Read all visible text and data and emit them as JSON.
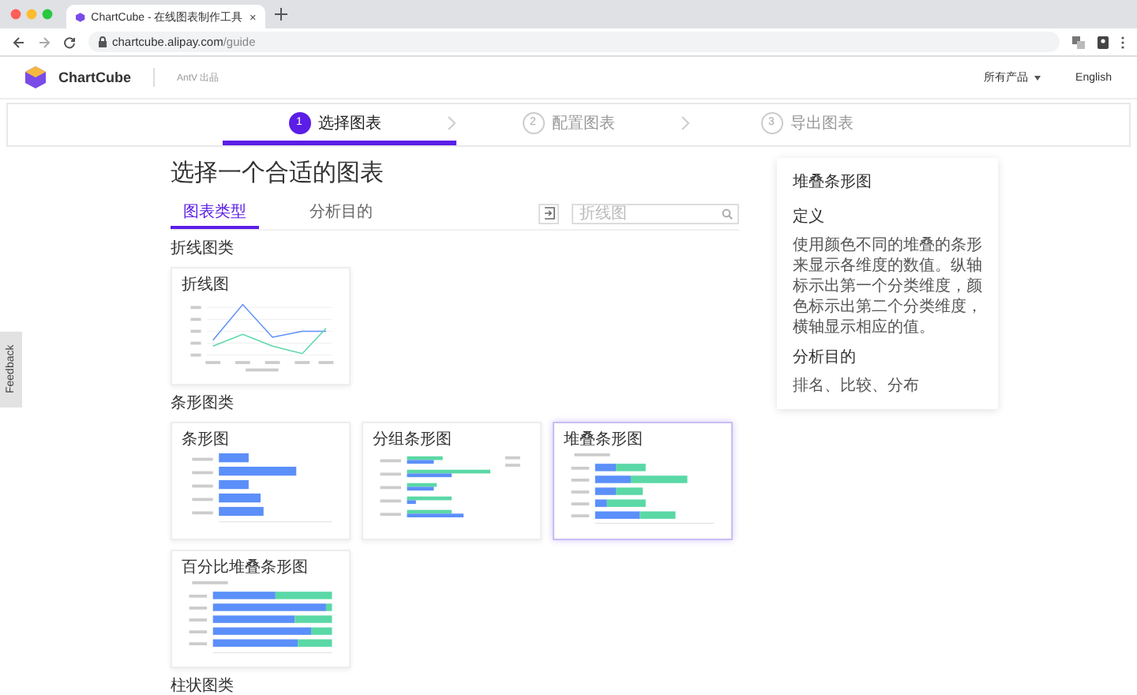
{
  "browser": {
    "tab_title": "ChartCube - 在线图表制作工具",
    "url_host": "chartcube.alipay.com",
    "url_path": "/guide"
  },
  "header": {
    "logo": "ChartCube",
    "byline": "AntV 出品",
    "menu": "所有产品",
    "language": "English"
  },
  "steps": [
    {
      "number": "1",
      "label": "选择图表",
      "selected": true
    },
    {
      "number": "2",
      "label": "配置图表",
      "selected": false
    },
    {
      "number": "3",
      "label": "导出图表",
      "selected": false
    }
  ],
  "page_title": "选择一个合适的图表",
  "tabs": [
    {
      "label": "图表类型",
      "selected": true
    },
    {
      "label": "分析目的",
      "selected": false
    }
  ],
  "search": {
    "placeholder": "折线图"
  },
  "sections": [
    {
      "title": "折线图类",
      "cards": [
        {
          "title": "折线图",
          "kind": "line",
          "selected": false
        }
      ]
    },
    {
      "title": "条形图类",
      "cards": [
        {
          "title": "条形图",
          "kind": "bar",
          "selected": false
        },
        {
          "title": "分组条形图",
          "kind": "grouped_bar",
          "selected": false
        },
        {
          "title": "堆叠条形图",
          "kind": "stacked_bar",
          "selected": true
        },
        {
          "title": "百分比堆叠条形图",
          "kind": "percent_bar",
          "selected": false
        }
      ]
    },
    {
      "title": "柱状图类"
    }
  ],
  "info_panel": {
    "title": "堆叠条形图",
    "sections": [
      {
        "heading": "定义",
        "text": "使用颜色不同的堆叠的条形来显示各维度的数值。纵轴标示出第一个分类维度，颜色标示出第二个分类维度，横轴显示相应的值。"
      },
      {
        "heading": "分析目的",
        "text": "排名、比较、分布"
      }
    ]
  },
  "feedback": "Feedback"
}
